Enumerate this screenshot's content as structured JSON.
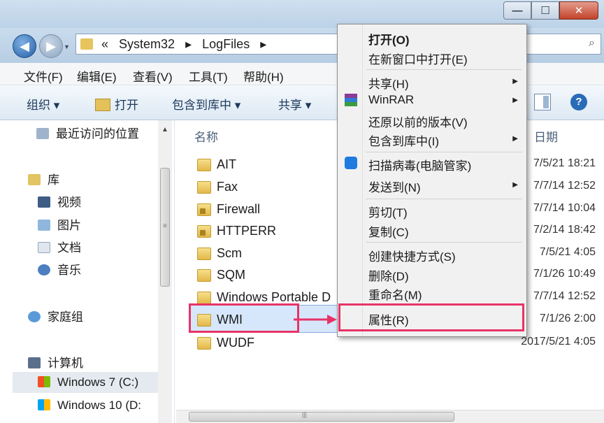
{
  "window": {
    "title": "LogFiles",
    "minimize_label": "—",
    "maximize_label": "☐",
    "close_label": "✕"
  },
  "address": {
    "back_icon": "back-arrow-icon",
    "forward_icon": "forward-arrow-icon",
    "crumbs": [
      "«",
      "System32",
      "▸",
      "LogFiles",
      "▸"
    ],
    "search_icon": "⌕"
  },
  "menubar": {
    "items": [
      "文件(F)",
      "编辑(E)",
      "查看(V)",
      "工具(T)",
      "帮助(H)"
    ]
  },
  "toolbar": {
    "organize": "组织 ▾",
    "open": "打开",
    "include_library": "包含到库中 ▾",
    "share": "共享 ▾",
    "help": "?"
  },
  "navpane": {
    "recent": "最近访问的位置",
    "library": "库",
    "videos": "视频",
    "pictures": "图片",
    "documents": "文档",
    "music": "音乐",
    "homegroup": "家庭组",
    "computer": "计算机",
    "drive_c": "Windows 7 (C:)",
    "drive_d": "Windows 10 (D:"
  },
  "filelist": {
    "col_name": "名称",
    "col_date": "日期",
    "rows": [
      {
        "name": "AIT",
        "date": "7/5/21 18:21",
        "locked": false
      },
      {
        "name": "Fax",
        "date": "7/7/14 12:52",
        "locked": false
      },
      {
        "name": "Firewall",
        "date": "7/7/14 10:04",
        "locked": true
      },
      {
        "name": "HTTPERR",
        "date": "7/2/14 18:42",
        "locked": true
      },
      {
        "name": "Scm",
        "date": "7/5/21 4:05",
        "locked": false
      },
      {
        "name": "SQM",
        "date": "7/1/26 10:49",
        "locked": false
      },
      {
        "name": "Windows Portable D",
        "date": "7/7/14 12:52",
        "locked": false
      },
      {
        "name": "WMI",
        "date": "7/1/26 2:00",
        "locked": false
      },
      {
        "name": "WUDF",
        "date": "2017/5/21 4:05",
        "locked": false
      }
    ]
  },
  "context_menu": {
    "open": "打开(O)",
    "open_new_window": "在新窗口中打开(E)",
    "share": "共享(H)",
    "winrar": "WinRAR",
    "restore_previous": "还原以前的版本(V)",
    "include_library": "包含到库中(I)",
    "scan_virus": "扫描病毒(电脑管家)",
    "send_to": "发送到(N)",
    "cut": "剪切(T)",
    "copy": "复制(C)",
    "create_shortcut": "创建快捷方式(S)",
    "delete": "删除(D)",
    "rename": "重命名(M)",
    "properties": "属性(R)"
  },
  "colors": {
    "highlight": "#e83367",
    "selection": "#d6e7fb"
  }
}
